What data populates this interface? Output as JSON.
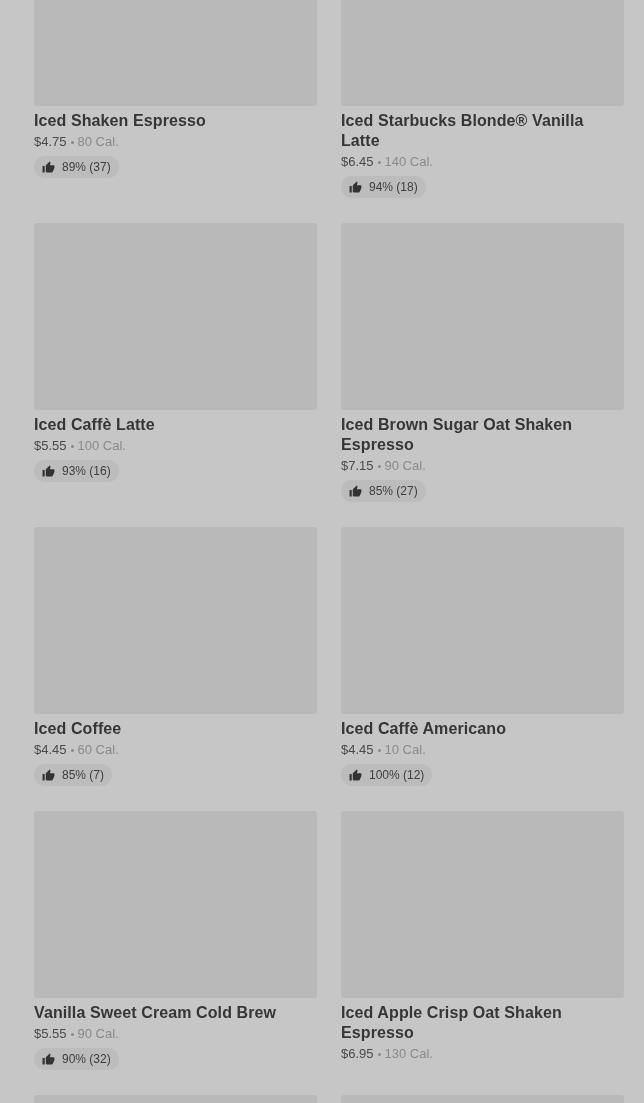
{
  "products": [
    {
      "kind": "product",
      "name": "Iced Shaken Espresso",
      "price": "$4.75",
      "calories": "80 Cal.",
      "rating": "89% (37)"
    },
    {
      "kind": "product",
      "name": "Iced Starbucks Blonde® Vanilla Latte",
      "price": "$6.45",
      "calories": "140 Cal.",
      "rating": "94% (18)"
    },
    {
      "kind": "product",
      "name": "Iced Caffè Latte",
      "price": "$5.55",
      "calories": "100 Cal.",
      "rating": "93% (16)"
    },
    {
      "kind": "product",
      "name": "Iced Brown Sugar Oat Shaken Espresso",
      "price": "$7.15",
      "calories": "90 Cal.",
      "rating": "85% (27)"
    },
    {
      "kind": "product",
      "name": "Iced Coffee",
      "price": "$4.45",
      "calories": "60 Cal.",
      "rating": "85% (7)"
    },
    {
      "kind": "product",
      "name": "Iced Caffè Americano",
      "price": "$4.45",
      "calories": "10 Cal.",
      "rating": "100% (12)"
    },
    {
      "kind": "product",
      "name": "Vanilla Sweet Cream Cold Brew",
      "price": "$5.55",
      "calories": "90 Cal.",
      "rating": "90% (32)"
    },
    {
      "kind": "product",
      "name": "Iced Apple Crisp Oat Shaken Espresso",
      "price": "$6.95",
      "calories": "130 Cal."
    },
    {
      "kind": "image_only"
    },
    {
      "kind": "image_only"
    }
  ]
}
